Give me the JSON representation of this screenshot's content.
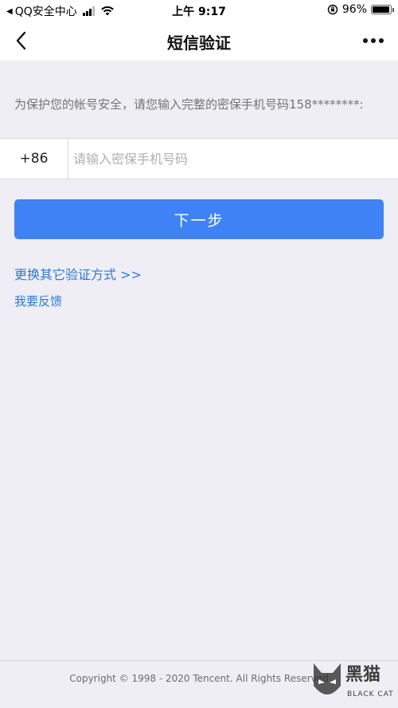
{
  "status_bar": {
    "back_app": "QQ安全中心",
    "time": "上午 9:17",
    "battery_percent": "96%",
    "battery_level": 0.96
  },
  "nav": {
    "title": "短信验证"
  },
  "main": {
    "prompt": "为保护您的帐号安全，请您输入完整的密保手机号码158********:",
    "country_code": "+86",
    "phone_placeholder": "请输入密保手机号码",
    "phone_value": "",
    "next_label": "下一步",
    "alt_verify_link": "更换其它验证方式 >>",
    "feedback_link": "我要反馈"
  },
  "footer": {
    "copyright": "Copyright © 1998 - 2020 Tencent. All Rights Reserved"
  },
  "watermark": {
    "brand": "黑猫",
    "brand_en": "BLACK CAT"
  },
  "colors": {
    "accent": "#3f82f6",
    "link": "#2b7bd6",
    "background": "#efeef4"
  }
}
